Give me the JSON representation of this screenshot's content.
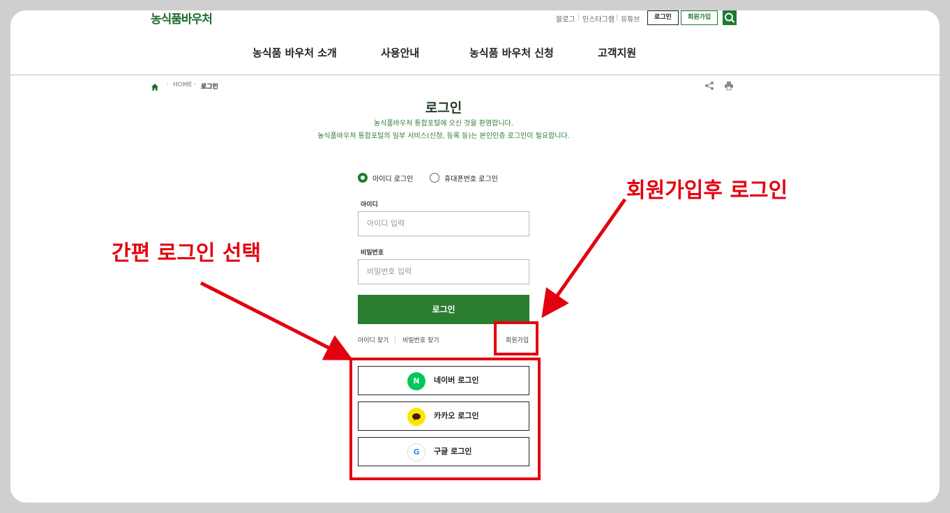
{
  "header": {
    "logo": "농식품바우처",
    "util_links": [
      "블로그",
      "인스타그램",
      "유튜브"
    ],
    "login_btn": "로그인",
    "join_btn": "회원가입"
  },
  "nav": {
    "items": [
      "농식품 바우처 소개",
      "사용안내",
      "농식품 바우처 신청",
      "고객지원"
    ]
  },
  "breadcrumb": {
    "home": "HOME",
    "current": "로그인"
  },
  "login": {
    "title": "로그인",
    "sub1": "농식품바우처 통합포털에 오신 것을 환영합니다.",
    "sub2": "농식품바우처 통합포털의 일부 서비스(신청, 등록 등)는 본인인증 로그인이 필요합니다.",
    "radio_id": "아이디 로그인",
    "radio_phone": "휴대폰번호 로그인",
    "id_label": "아이디",
    "id_placeholder": "아이디 입력",
    "pw_label": "비밀번호",
    "pw_placeholder": "비밀번호 입력",
    "submit": "로그인",
    "find_id": "아이디 찾기",
    "find_pw": "비밀번호 찾기",
    "join": "회원가입"
  },
  "social": {
    "naver": "네이버 로그인",
    "naver_icon_text": "N",
    "kakao": "카카오 로그인",
    "google": "구글 로그인",
    "google_icon_text": "G"
  },
  "annotations": {
    "left": "간편 로그인 선택",
    "right": "회원가입후 로그인"
  },
  "colors": {
    "brand_green": "#2a7d2e",
    "annotation_red": "#e3000f",
    "naver_green": "#03c75a",
    "kakao_yellow": "#fee500"
  }
}
